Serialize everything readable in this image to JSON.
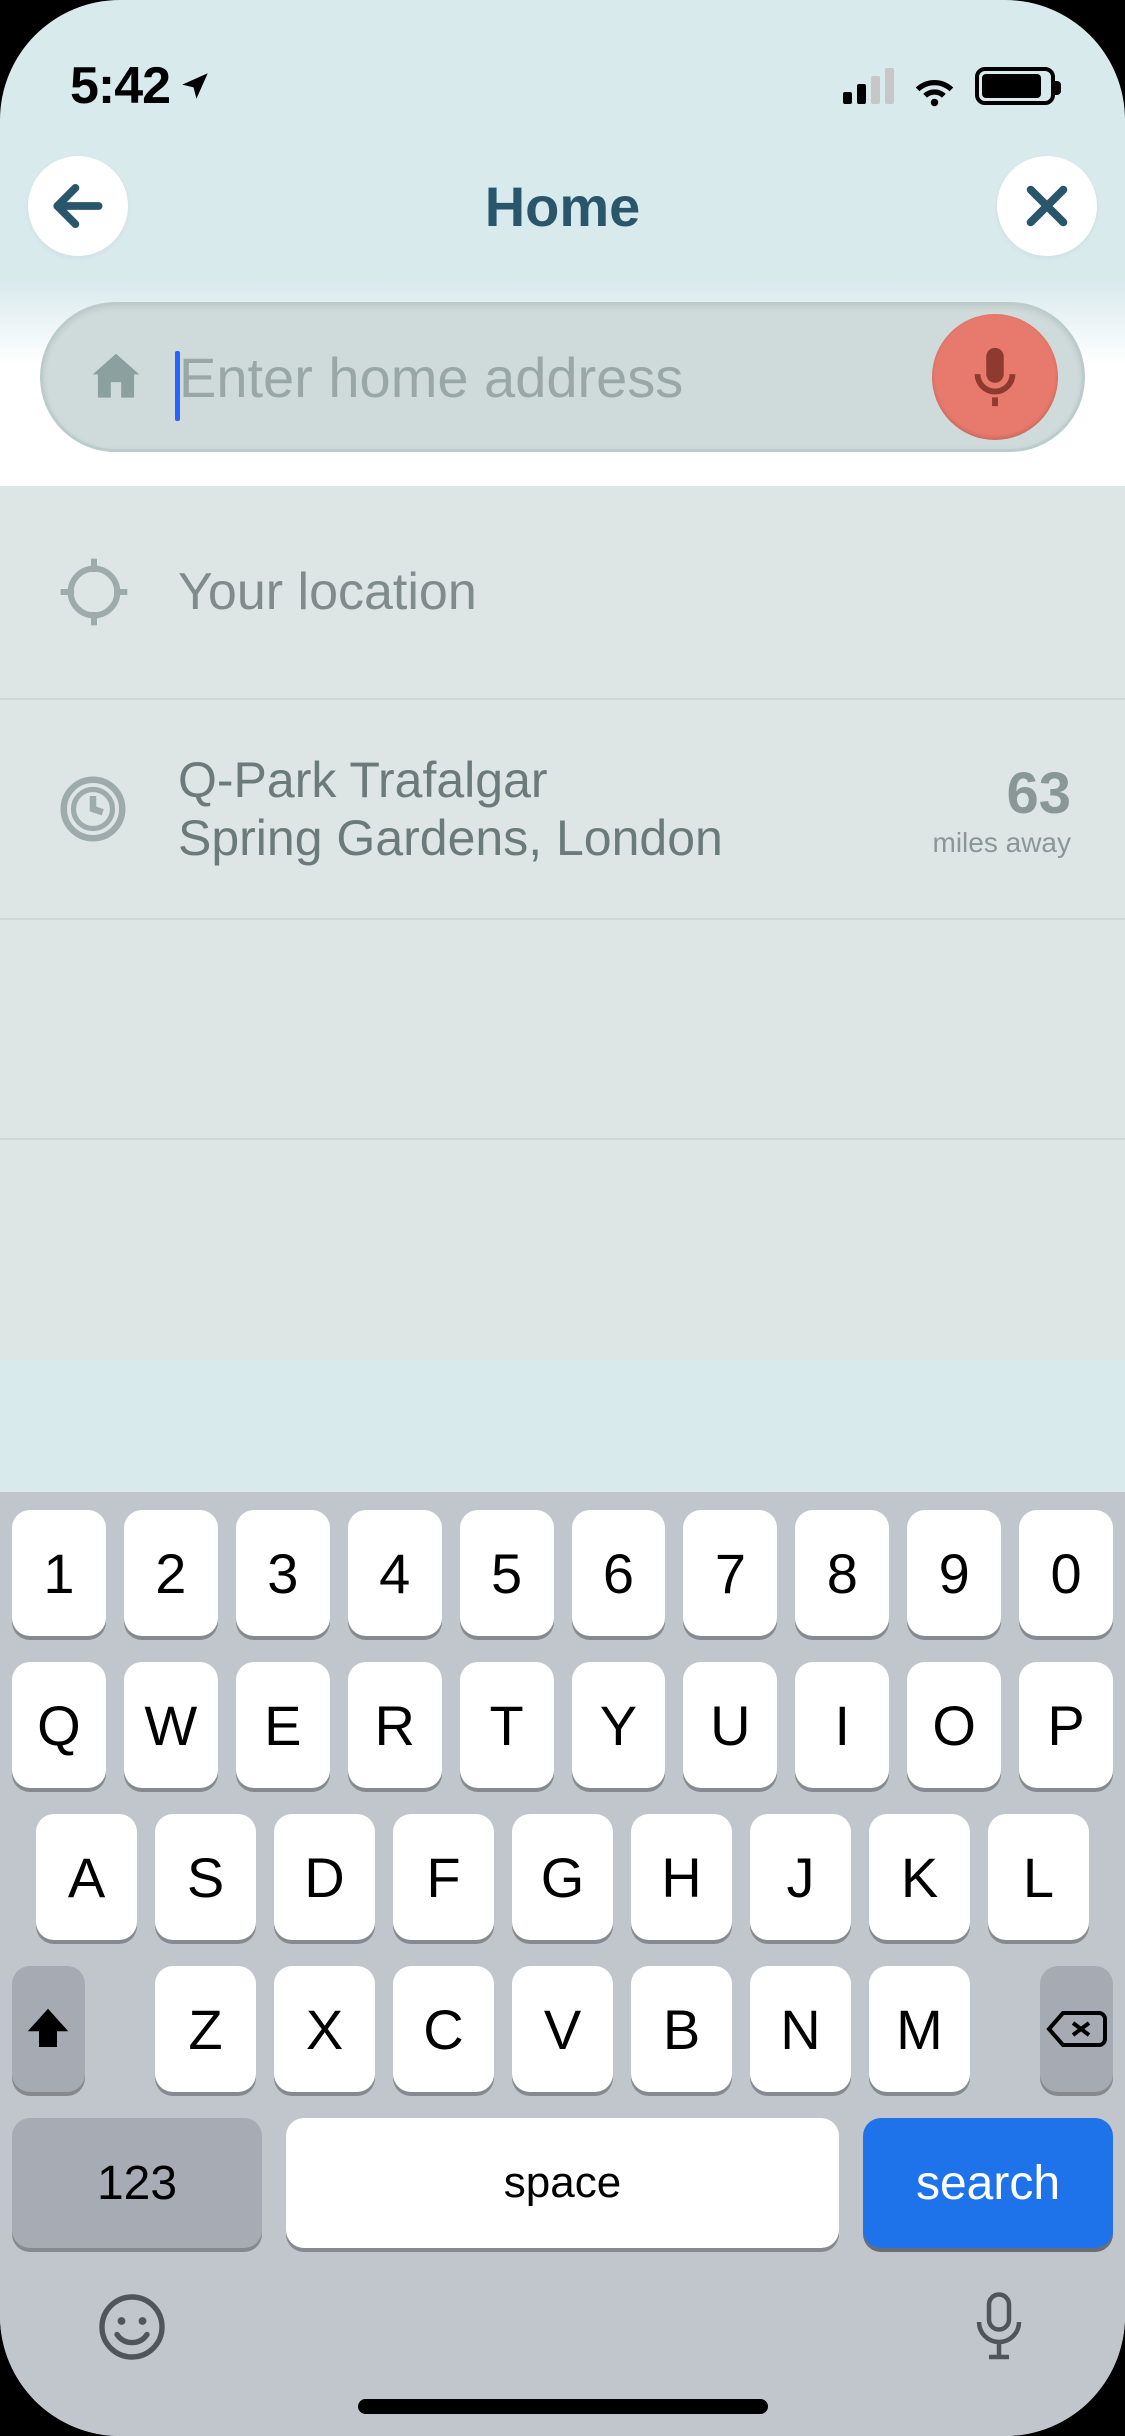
{
  "status": {
    "time": "5:42"
  },
  "header": {
    "title": "Home"
  },
  "search": {
    "placeholder": "Enter home address"
  },
  "list": {
    "your_location_label": "Your location",
    "recent": {
      "name": "Q-Park Trafalgar",
      "detail": "Spring Gardens, London",
      "distance_value": "63",
      "distance_unit": "miles away"
    }
  },
  "keyboard": {
    "row1": [
      "1",
      "2",
      "3",
      "4",
      "5",
      "6",
      "7",
      "8",
      "9",
      "0"
    ],
    "row2": [
      "Q",
      "W",
      "E",
      "R",
      "T",
      "Y",
      "U",
      "I",
      "O",
      "P"
    ],
    "row3": [
      "A",
      "S",
      "D",
      "F",
      "G",
      "H",
      "J",
      "K",
      "L"
    ],
    "row4": [
      "Z",
      "X",
      "C",
      "V",
      "B",
      "N",
      "M"
    ],
    "fn_label": "123",
    "space_label": "space",
    "action_label": "search"
  }
}
